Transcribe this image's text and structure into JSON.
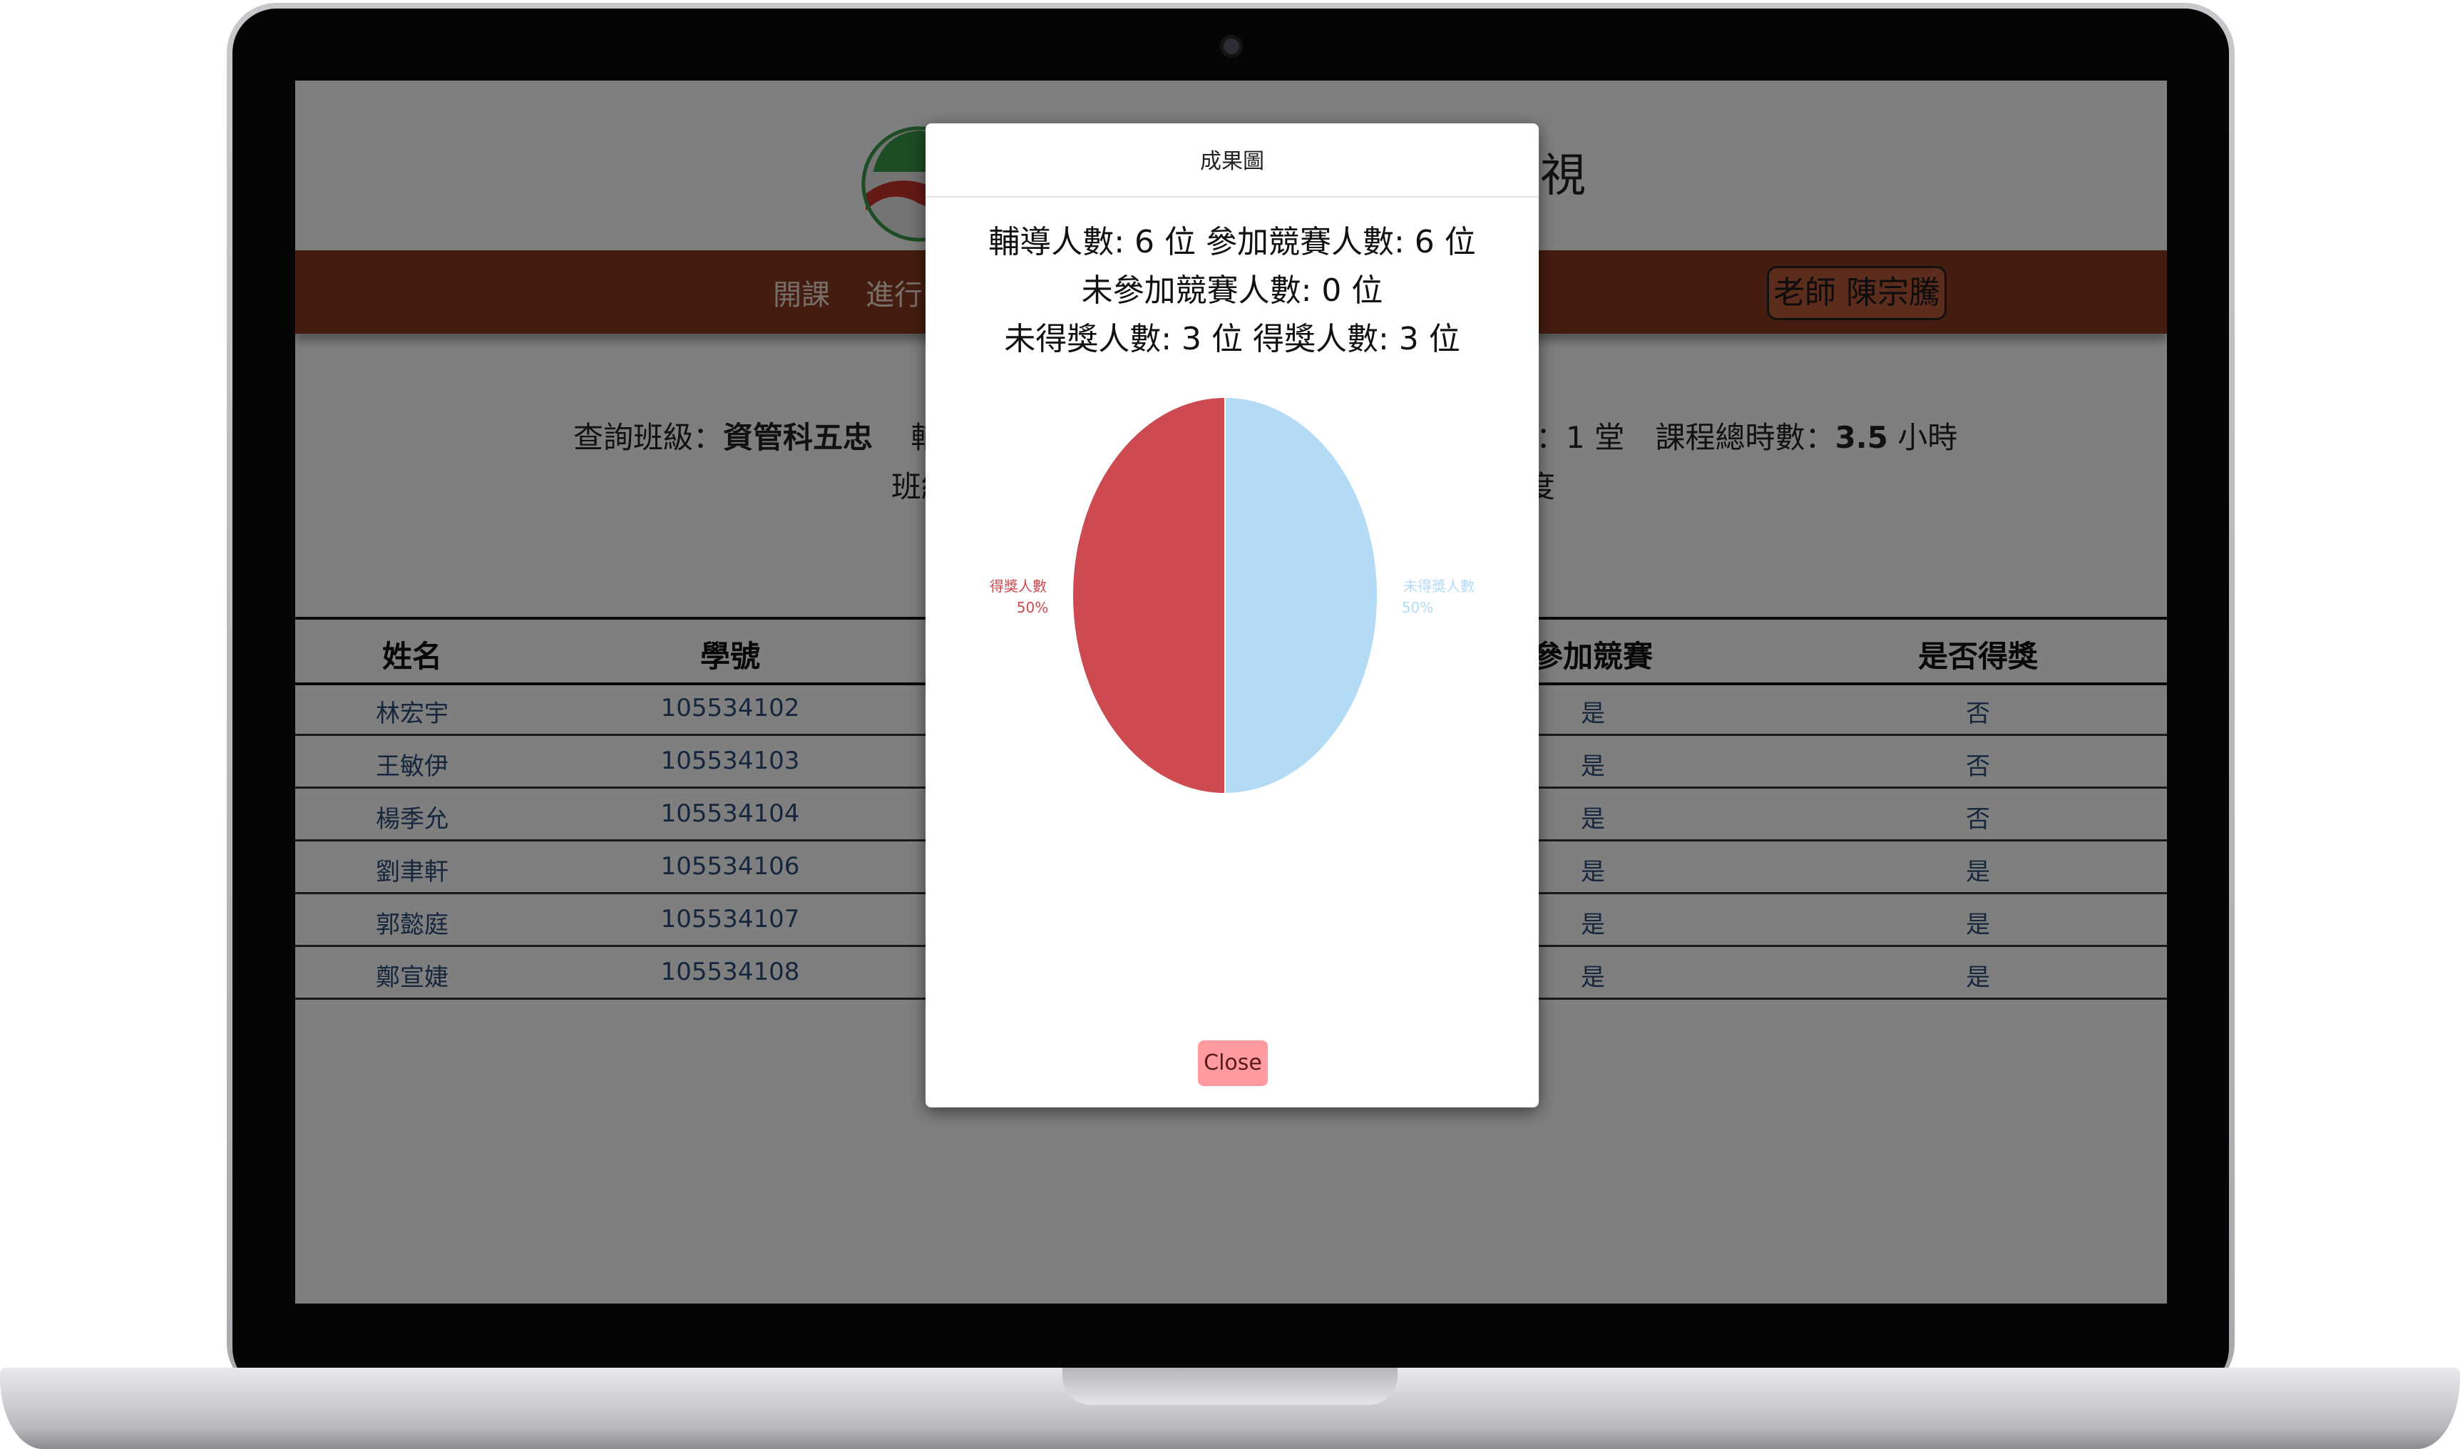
{
  "header": {
    "title_visible_fragment": "檢視"
  },
  "nav": {
    "items": [
      "開課",
      "進行中"
    ],
    "teacher_label": "老師 陳宗騰"
  },
  "info": {
    "class_label": "查詢班級：",
    "class_value": "資管科五忠",
    "tutor_label": "輔導",
    "sessions_tail": "：1 堂",
    "hours_label": "課程總時數：",
    "hours_value": "3.5",
    "hours_unit": "小時",
    "line2_start": "班級",
    "line2_end": "度"
  },
  "table": {
    "headers": [
      "姓名",
      "學號",
      "參加競賽",
      "是否得獎"
    ],
    "rows": [
      {
        "name": "林宏宇",
        "id": "105534102",
        "competed": "是",
        "awarded": "否"
      },
      {
        "name": "王敏伊",
        "id": "105534103",
        "competed": "是",
        "awarded": "否"
      },
      {
        "name": "楊季允",
        "id": "105534104",
        "competed": "是",
        "awarded": "否"
      },
      {
        "name": "劉聿軒",
        "id": "105534106",
        "competed": "是",
        "awarded": "是"
      },
      {
        "name": "郭懿庭",
        "id": "105534107",
        "competed": "是",
        "awarded": "是"
      },
      {
        "name": "鄭宣婕",
        "id": "105534108",
        "competed": "是",
        "awarded": "是"
      }
    ]
  },
  "modal": {
    "title": "成果圖",
    "stats_line1": "輔導人數: 6 位 參加競賽人數: 6 位",
    "stats_line2": "未參加競賽人數: 0 位",
    "stats_line3": "未得獎人數: 3 位 得獎人數: 3 位",
    "close_label": "Close"
  },
  "colors": {
    "navbar": "#8a3a20",
    "awarded_slice": "#cc4a50",
    "not_awarded_slice": "#b3dbf6",
    "close_button": "#ff9aa0"
  },
  "chart_data": {
    "type": "pie",
    "slices": [
      {
        "label": "得獎人數",
        "value": 50,
        "value_label": "50%",
        "color": "#cc4a50"
      },
      {
        "label": "未得獎人數",
        "value": 50,
        "value_label": "50%",
        "color": "#b3dbf6"
      }
    ]
  }
}
